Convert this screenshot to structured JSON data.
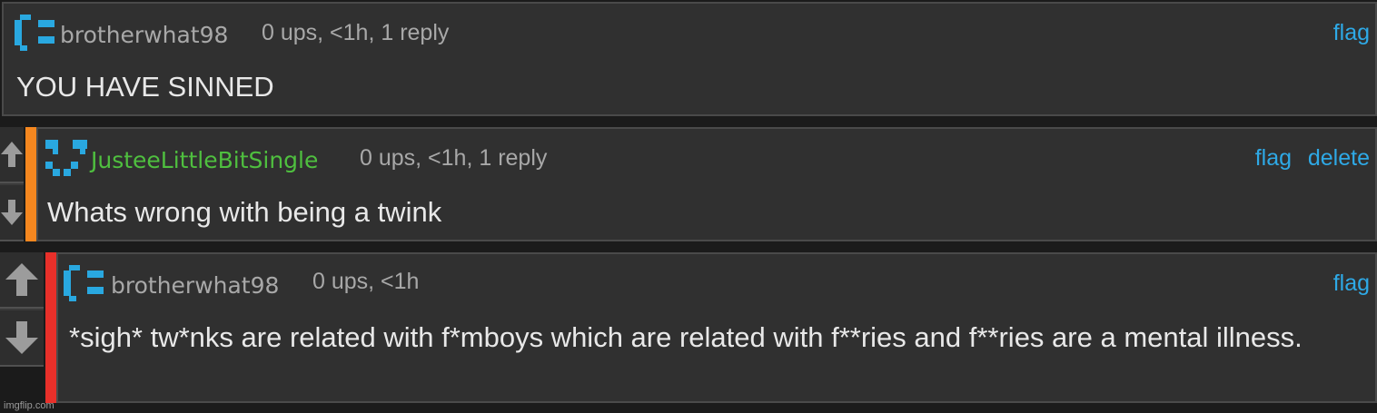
{
  "comments": [
    {
      "username": "brotherwhat98",
      "meta": "0 ups, <1h, 1 reply",
      "actions": [
        "flag"
      ],
      "body": "YOU HAVE SINNED",
      "username_color": "#a8a8a8"
    },
    {
      "username": "JusteeLittleBitSingle",
      "meta": "0 ups, <1h, 1 reply",
      "actions": [
        "flag",
        "delete"
      ],
      "body": "Whats wrong with being a twink",
      "username_color": "#4fbf3f",
      "depth_color": "#f5871f"
    },
    {
      "username": "brotherwhat98",
      "meta": "0 ups, <1h",
      "actions": [
        "flag"
      ],
      "body": "*sigh* tw*nks are related with f*mboys which are related with f**ries and f**ries are a mental illness.",
      "username_color": "#a8a8a8",
      "depth_color": "#e8302a"
    }
  ],
  "icons": {
    "upvote": "arrow-up-icon",
    "downvote": "arrow-down-icon",
    "avatar": "pixel-avatar-icon"
  },
  "colors": {
    "link": "#2ea9e6",
    "avatar": "#29a8e0"
  },
  "watermark": "imgflip.com"
}
